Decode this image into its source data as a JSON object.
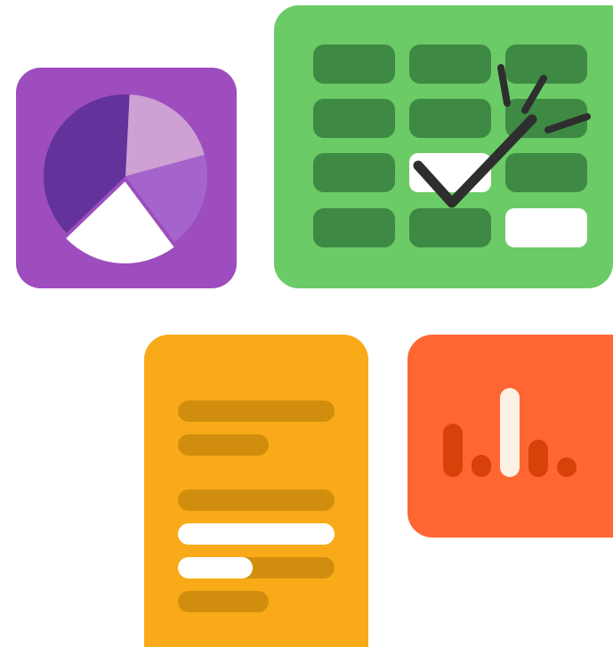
{
  "illustration": {
    "tiles": [
      {
        "name": "pie-chart-tile",
        "icon": "pie-chart-icon",
        "color": "#9D4DBE"
      },
      {
        "name": "spreadsheet-tile",
        "icon": "spreadsheet-check-icon",
        "color": "#6BCB66"
      },
      {
        "name": "document-tile",
        "icon": "document-lines-icon",
        "color": "#F9AA19"
      },
      {
        "name": "bar-chart-tile",
        "icon": "bar-chart-icon",
        "color": "#FF6633"
      }
    ],
    "pie_slices": [
      {
        "color": "#CFA0D3",
        "fraction": 0.2
      },
      {
        "color": "#A564CC",
        "fraction": 0.19
      },
      {
        "color": "#FFFFFF",
        "fraction": 0.23
      },
      {
        "color": "#63339B",
        "fraction": 0.38
      }
    ],
    "bar_heights": [
      0.6,
      0.25,
      1.0,
      0.42,
      0.18
    ],
    "bar_colors": [
      "#D64209",
      "#D64209",
      "#FAF1E4",
      "#D64209",
      "#D64209"
    ]
  }
}
